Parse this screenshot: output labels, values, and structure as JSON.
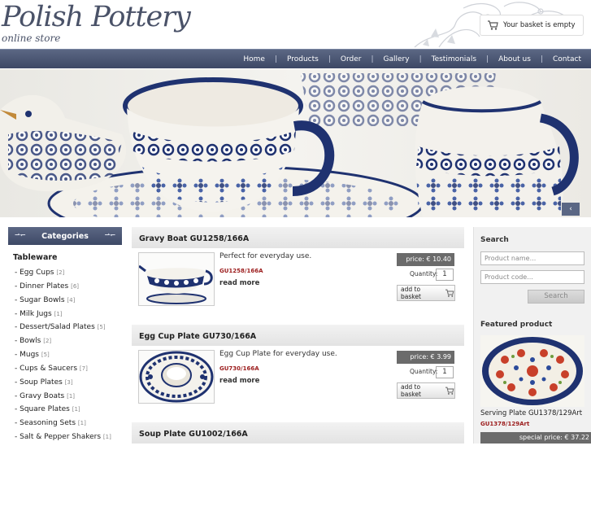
{
  "header": {
    "logo_title": "Polish Pottery",
    "logo_subtitle": "online store",
    "basket_text": "Your basket is empty"
  },
  "nav": {
    "items": [
      "Home",
      "Products",
      "Order",
      "Gallery",
      "Testimonials",
      "About us",
      "Contact"
    ]
  },
  "hero": {
    "arrow": "‹"
  },
  "sidebar": {
    "heading": "Categories",
    "group": "Tableware",
    "items": [
      {
        "label": "- Egg Cups",
        "count": "[2]"
      },
      {
        "label": "- Dinner Plates",
        "count": "[6]"
      },
      {
        "label": "- Sugar Bowls",
        "count": "[4]"
      },
      {
        "label": "- Milk Jugs",
        "count": "[1]"
      },
      {
        "label": "- Dessert/Salad Plates",
        "count": "[5]"
      },
      {
        "label": "- Bowls",
        "count": "[2]"
      },
      {
        "label": "- Mugs",
        "count": "[5]"
      },
      {
        "label": "- Cups & Saucers",
        "count": "[7]"
      },
      {
        "label": "- Soup Plates",
        "count": "[3]"
      },
      {
        "label": "- Gravy Boats",
        "count": "[1]"
      },
      {
        "label": "- Square Plates",
        "count": "[1]"
      },
      {
        "label": "- Seasoning Sets",
        "count": "[1]"
      },
      {
        "label": "- Salt & Pepper Shakers",
        "count": "[1]"
      }
    ]
  },
  "products": [
    {
      "title": "Gravy Boat GU1258/166A",
      "desc": "Perfect for everyday use.",
      "code": "GU1258/166A",
      "more": "read more",
      "price": "price: € 10.40",
      "qty_label": "Quantity:",
      "qty": "1",
      "add": "add to basket"
    },
    {
      "title": "Egg Cup Plate GU730/166A",
      "desc": "Egg Cup Plate for everyday use.",
      "code": "GU730/166A",
      "more": "read more",
      "price": "price: € 3.99",
      "qty_label": "Quantity:",
      "qty": "1",
      "add": "add to basket"
    },
    {
      "title": "Soup Plate GU1002/166A"
    }
  ],
  "search": {
    "title": "Search",
    "name_placeholder": "Product name...",
    "code_placeholder": "Product code...",
    "button": "Search"
  },
  "featured": {
    "title": "Featured product",
    "name": "Serving Plate GU1378/129Art",
    "code": "GU1378/129Art",
    "price": "special price: € 37.22"
  },
  "colors": {
    "nav": "#4a5572",
    "accent_red": "#9b1b1b",
    "price_bg": "#6b6b6b",
    "pottery_blue": "#1f3270"
  }
}
